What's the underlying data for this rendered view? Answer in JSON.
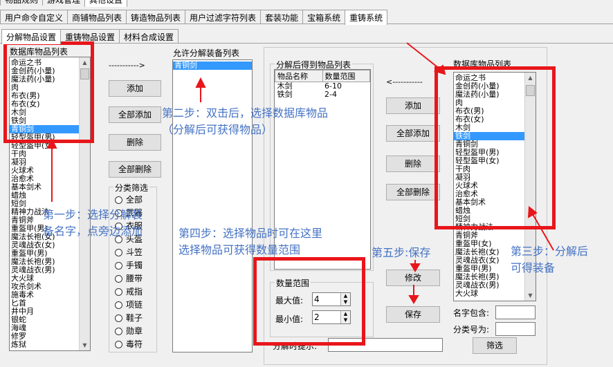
{
  "top_tabs_partial": [
    "物品规则",
    "游戏管理",
    "其他设置"
  ],
  "main_tabs": [
    "用户命令自定义",
    "商铺物品列表",
    "铸造物品列表",
    "用户过滤字符列表",
    "套装功能",
    "宝箱系统",
    "重铸系统"
  ],
  "sub_tabs": [
    "分解物品设置",
    "重铸物品设置",
    "材料合成设置"
  ],
  "left_list": {
    "title": "数据库物品列表",
    "items": [
      "命运之书",
      "金创药(小量)",
      "魔法药(小量)",
      "肉",
      "布衣(男)",
      "布衣(女)",
      "木剑",
      "铁剑",
      "青铜剑",
      "轻型盔甲(男)",
      "轻型盔甲(女)",
      "干肉",
      "凝羽",
      "火球术",
      "治愈术",
      "基本剑术",
      "蜡烛",
      "短剑",
      "精神力战法",
      "青铜斧",
      "重盔甲(男)",
      "魔法长袍(女)",
      "灵魂战衣(女)",
      "重盔甲(男)",
      "魔法长袍(男)",
      "灵魂战衣(男)",
      "大火球",
      "攻杀剑术",
      "施毒术",
      "匕首",
      "井中月",
      "银蛇",
      "海魂",
      "修罗",
      "炼狱"
    ],
    "selected_index": 8
  },
  "dashed_arrow": "----------->",
  "left_buttons": [
    "添加",
    "全部添加",
    "删除",
    "全部删除"
  ],
  "filter": {
    "label": "分类筛选",
    "options": [
      "全部",
      "武器",
      "衣服",
      "头盔",
      "斗笠",
      "手镯",
      "腰带",
      "戒指",
      "项链",
      "鞋子",
      "勋章",
      "毒符"
    ]
  },
  "allowed_list": {
    "title": "允许分解装备列表",
    "items": [
      "青铜剑"
    ]
  },
  "result_group": {
    "title": "分解后得到物品列表",
    "headers": [
      "物品名称",
      "数量范围"
    ],
    "rows": [
      [
        "木剑",
        "6-10"
      ],
      [
        "铁剑",
        "2-4"
      ]
    ]
  },
  "dashed_arrow_left": "<-----------",
  "right_buttons": [
    "添加",
    "全部添加",
    "删除",
    "全部删除"
  ],
  "quantity": {
    "title": "数量范围",
    "max_label": "最大值:",
    "max_value": "4",
    "min_label": "最小值:",
    "min_value": "2"
  },
  "modify_button": "修改",
  "save_button": "保存",
  "hint_label": "分解时提示:",
  "right_list": {
    "title": "数据库物品列表",
    "items": [
      "命运之书",
      "金创药(小量)",
      "魔法药(小量)",
      "肉",
      "布衣(男)",
      "布衣(女)",
      "木剑",
      "铁剑",
      "青铜剑",
      "轻型盔甲(男)",
      "轻型盔甲(女)",
      "干肉",
      "凝羽",
      "火球术",
      "治愈术",
      "基本剑术",
      "蜡烛",
      "短剑",
      "精神力战法",
      "青铜斧",
      "重盔甲(女)",
      "魔法长袍(女)",
      "灵魂战衣(女)",
      "重盔甲(男)",
      "魔法长袍(男)",
      "灵魂战衣(男)",
      "大火球"
    ],
    "selected_index": 7
  },
  "name_contains_label": "名字包含:",
  "category_label": "分类号为:",
  "filter_button": "筛选",
  "notes": {
    "step1_line1": "第一步：选择分解装",
    "step1_line2": "备名字，点旁边添加",
    "step2_line1": "第二步：双击后，选择数据库物品",
    "step2_line2": "（分解后可获得物品）",
    "step3_line1": "第三步：分解后",
    "step3_line2": "可得装备",
    "step4_line1": "第四步：选择物品时可在这里",
    "step4_line2": "选择物品可获得数量范围",
    "step5": "第五步:保存"
  },
  "colors": {
    "annotation_red": "#e8161b",
    "annotation_blue": "#4472c4",
    "selection": "#3399ff"
  }
}
